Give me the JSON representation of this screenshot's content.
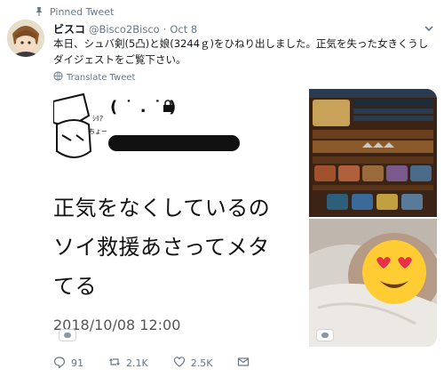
{
  "pinned": {
    "label": "Pinned Tweet"
  },
  "tweet": {
    "display_name": "ビスコ",
    "handle": "@Bisco2Bisco",
    "separator": "·",
    "date": "Oct 8",
    "text": "本日、シュバ剣(5凸)と娘(3244ｇ)をひねり出しました。正気を失った女きくうしダイジェストをご覧下さい。",
    "translate_label": "Translate Tweet"
  },
  "media": {
    "screenshot": {
      "face": "( ˙ . ˙ )",
      "line1": "正気をなくしているの",
      "line2": "ソイ救援あさってメタ",
      "line3": "てる",
      "timestamp": "2018/10/08 12:00"
    }
  },
  "actions": {
    "reply_count": "91",
    "retweet_count": "2.1K",
    "like_count": "2.5K"
  },
  "icons": {
    "pin": "pin-icon",
    "caret": "chevron-down-icon",
    "globe": "globe-icon",
    "reply": "reply-icon",
    "retweet": "retweet-icon",
    "like": "heart-icon",
    "dm": "envelope-icon"
  },
  "colors": {
    "secondary_text": "#657786",
    "primary_text": "#14171a"
  }
}
